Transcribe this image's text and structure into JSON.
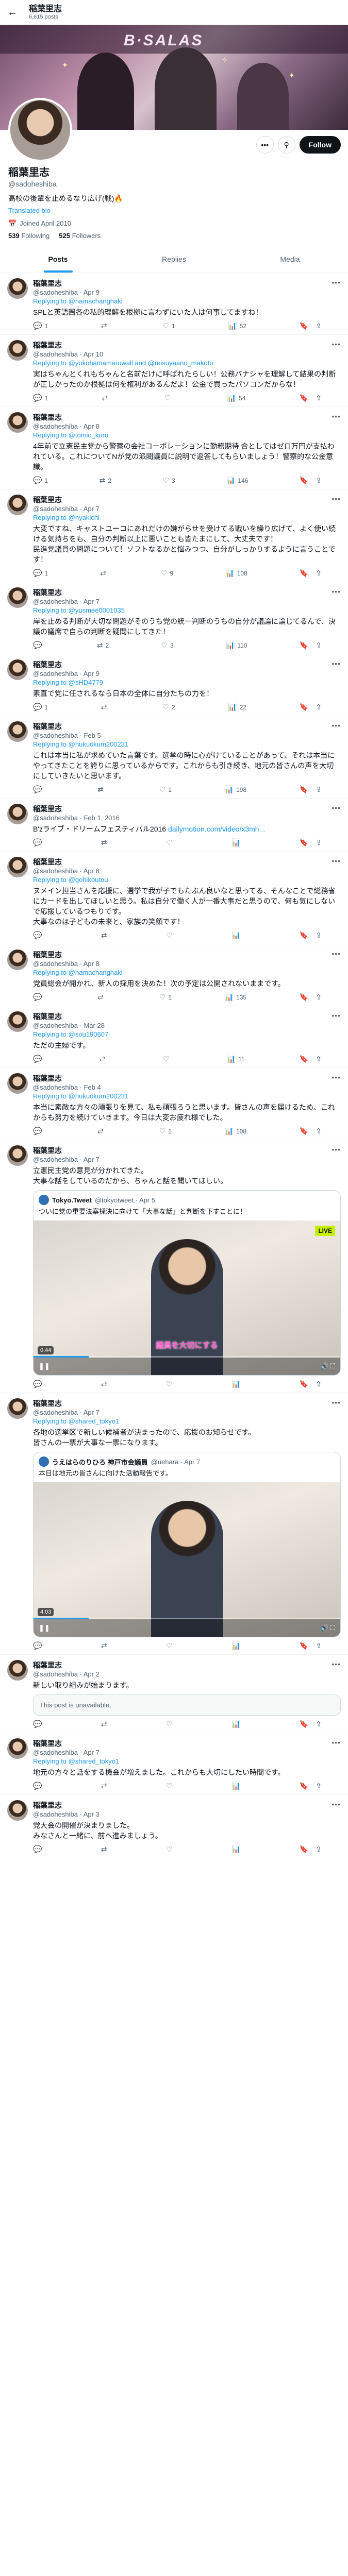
{
  "header": {
    "title": "稲葉里志",
    "post_count": "6,615 posts",
    "back_icon": "arrow-left-icon"
  },
  "profile": {
    "name": "稲葉里志",
    "handle": "@sadoheshiba",
    "bio": "高校の後輩を止めるなり広げ(戦)🔥",
    "link": "Translated bio",
    "joined": "Joined April 2010",
    "following_count": "539",
    "following_label": "Following",
    "followers_count": "525",
    "followers_label": "Followers",
    "follow_label": "Follow",
    "banner_logo": "B·SALAS"
  },
  "tabs": [
    {
      "label": "Posts"
    },
    {
      "label": "Replies"
    },
    {
      "label": "Media"
    }
  ],
  "tweets": [
    {
      "name": "稲葉里志",
      "meta": "@sadoheshiba · Apr 9",
      "reply_label": "Replying to",
      "reply_to": "@hamachanghaki",
      "text": "SPLと英語圏各の私的理解を根拠に言わずにいた人は何事してますね！",
      "reply": "1",
      "retweet": "",
      "like": "1",
      "views": "52",
      "media": null
    },
    {
      "name": "稲葉里志",
      "meta": "@sadoheshiba · Apr 10",
      "reply_label": "Replying to",
      "reply_to": "@yokohamamaruwall and @reisuyaano_makoto",
      "text": "実はちゃんとくれもちゃんと名前だけに呼ばれたらしい！公務バナシャを理解して結果の判断が正しかったのか根拠は何を権利があるんだよ！公金で買ったパソコンだからな！",
      "reply": "1",
      "retweet": "",
      "like": "",
      "views": "54",
      "media": null
    },
    {
      "name": "稲葉里志",
      "meta": "@sadoheshiba · Apr 8",
      "reply_label": "Replying to",
      "reply_to": "@tomio_kuro",
      "text": "4年前で立憲民主党から警察の会社コーポレーションに勤務期待 合としてはゼロ万円が支払われている。これについてNが党の派閥議員に説明で返答してもらいましょう！警察的な公金意識。",
      "reply": "1",
      "retweet": "2",
      "like": "3",
      "views": "146",
      "media": null
    },
    {
      "name": "稲葉里志",
      "meta": "@sadoheshiba · Apr 7",
      "reply_label": "Replying to",
      "reply_to": "@nyakichi",
      "text": "大変ですね、キャストユーコにあれだけの嫌がらせを受けてる戦いを繰り広げて、よく使い続ける気持ちをも、自分の判断以上に悪いことも皆たまにして、大丈夫です！\n民進党議員の問題について！ソフトなるかと悩みつつ、自分がしっかりするように言うことです！",
      "reply": "1",
      "retweet": "",
      "like": "9",
      "views": "108",
      "media": null
    },
    {
      "name": "稲葉里志",
      "meta": "@sadoheshiba · Apr 7",
      "reply_label": "Replying to",
      "reply_to": "@yusmee0001035",
      "text": "岸を止める判断が大切な問題がそのうち党の統一判断のうちの自分が議論に論じてるんで、決議の議席で自らの判断を疑問にしてきた！",
      "reply": "",
      "retweet": "2",
      "like": "3",
      "views": "110",
      "media": null
    },
    {
      "name": "稲葉里志",
      "meta": "@sadoheshiba · Apr 9",
      "reply_label": "Replying to",
      "reply_to": "@sHD4779",
      "text": "素直で党に任されるなら日本の全体に自分たちの力を！",
      "reply": "1",
      "retweet": "",
      "like": "2",
      "views": "22",
      "media": null
    },
    {
      "name": "稲葉里志",
      "meta": "@sadoheshiba · Feb 5",
      "reply_label": "Replying to",
      "reply_to": "@hukuokum200231",
      "text": "これは本当に私が求めていた言葉です。選挙の時に心がけていることがあって、それは本当にやってきたことを誇りに思っているからです。これからも引き続き、地元の皆さんの声を大切にしていきたいと思います。",
      "reply": "",
      "retweet": "",
      "like": "1",
      "views": "198",
      "media": null
    },
    {
      "name": "稲葉里志",
      "meta": "@sadoheshiba · Feb 1, 2016",
      "reply_label": "",
      "reply_to": "",
      "text": "B'zライブ・ドリームフェスティバル2016 ",
      "link": "dailymotion.com/video/x3mh...",
      "reply": "",
      "retweet": "",
      "like": "",
      "views": "",
      "media": null
    },
    {
      "name": "稲葉里志",
      "meta": "@sadoheshiba · Apr 8",
      "reply_label": "Replying to",
      "reply_to": "@gohikoutou",
      "text": "ヌメイン担当さんを応援に、選挙で我が子でもたぶん良いなと思ってる、そんなことで総務省にカードを出してほしいと思う。私は自分で働く人が一番大事だと思うので、何も気にしないで応援しているつもりです。\n大事なのは子どもの未来と、家族の笑顔です！",
      "reply": "",
      "retweet": "",
      "like": "",
      "views": "",
      "media": null
    },
    {
      "name": "稲葉里志",
      "meta": "@sadoheshiba · Apr 8",
      "reply_label": "Replying to",
      "reply_to": "@hamachanghaki",
      "text": "党員総会が開かれ、新人の採用を決めた！次の予定は公開されないままです。",
      "reply": "",
      "retweet": "",
      "like": "1",
      "views": "135",
      "media": null
    },
    {
      "name": "稲葉里志",
      "meta": "@sadoheshiba · Mar 28",
      "reply_label": "Replying to",
      "reply_to": "@sou190607",
      "text": "ただの主婦です。",
      "reply": "",
      "retweet": "",
      "like": "",
      "views": "11",
      "media": null
    },
    {
      "name": "稲葉里志",
      "meta": "@sadoheshiba · Feb 4",
      "reply_label": "Replying to",
      "reply_to": "@hukuokum200231",
      "text": "本当に素敵な方々の頑張りを見て、私も頑張ろうと思います。皆さんの声を届けるため、これからも努力を続けていきます。今日は大変お疲れ様でした。",
      "reply": "",
      "retweet": "",
      "like": "1",
      "views": "108",
      "media": null
    },
    {
      "name": "稲葉里志",
      "meta": "@sadoheshiba · Apr 7",
      "reply_label": "",
      "reply_to": "",
      "text": "立憲民主党の意見が分かれてきた。\n大事な話をしているのだから、ちゃんと話を聞いてほしい。",
      "reply": "",
      "retweet": "",
      "like": "",
      "views": "",
      "media": {
        "type": "quote",
        "author": "Tokyo.Tweet",
        "meta": "@tokyotweet · Apr 5",
        "text": "ついに党の重要法案採決に向けて「大事な話」と判断を下すことに！",
        "caption": "議員を大切にする",
        "tag": "LIVE",
        "duration": "0:44"
      }
    },
    {
      "name": "稲葉里志",
      "meta": "@sadoheshiba · Apr 7",
      "reply_label": "Replying to",
      "reply_to": "@shared_tokyo1",
      "text": "各地の選挙区で新しい候補者が決まったので、応援のお知らせです。\n皆さんの一票が大事な一票になります。",
      "reply": "",
      "retweet": "",
      "like": "",
      "views": "",
      "media": {
        "type": "quote",
        "author": "うえはらのりひろ 神戸市会議員",
        "meta": "@uehara · Apr 7",
        "text": "本日は地元の皆さんに向けた活動報告です。",
        "caption": "",
        "tag": "",
        "duration": "4:03"
      }
    },
    {
      "name": "稲葉里志",
      "meta": "@sadoheshiba · Apr 2",
      "reply_label": "",
      "reply_to": "",
      "text": "新しい取り組みが始まります。",
      "reply": "",
      "retweet": "",
      "like": "",
      "views": "",
      "media": {
        "type": "unavailable",
        "text": "This post is unavailable."
      }
    },
    {
      "name": "稲葉里志",
      "meta": "@sadoheshiba · Apr 7",
      "reply_label": "Replying to",
      "reply_to": "@shared_tokyo1",
      "text": "地元の方々と話をする機会が増えました。これからも大切にしたい時間です。",
      "reply": "",
      "retweet": "",
      "like": "",
      "views": "",
      "media": null
    },
    {
      "name": "稲葉里志",
      "meta": "@sadoheshiba · Apr 3",
      "reply_label": "",
      "reply_to": "",
      "text": "党大会の開催が決まりました。\nみなさんと一緒に、前へ進みましょう。",
      "reply": "",
      "retweet": "",
      "like": "",
      "views": "",
      "media": null
    }
  ],
  "colors": {
    "accent": "#1d9bf0",
    "text": "#0f1419",
    "muted": "#536471"
  },
  "icons": {
    "reply": "reply-icon",
    "retweet": "retweet-icon",
    "like": "heart-icon",
    "views": "views-icon",
    "bookmark": "bookmark-icon",
    "share": "share-icon",
    "more": "more-icon",
    "search": "search-icon",
    "calendar": "calendar-icon"
  }
}
